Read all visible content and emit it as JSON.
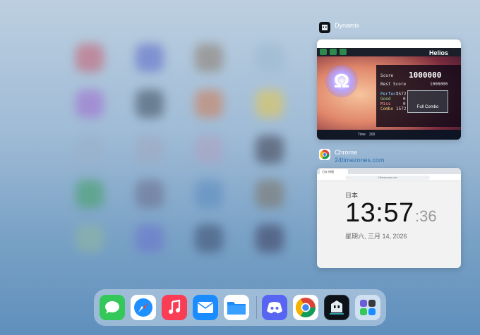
{
  "switcher": {
    "cards": [
      {
        "app_name": "Dynamix",
        "subtitle": "",
        "icon": "dynamix-icon",
        "game": {
          "song_title": "Helios",
          "score_label": "Score",
          "score_value": "1000000",
          "best_score_label": "Best Score",
          "best_score_value": "1000000",
          "perfect_label": "Perfect",
          "perfect_value": "1572",
          "good_label": "Good",
          "good_value": "0",
          "miss_label": "Miss",
          "miss_value": "0",
          "combo_label": "Combo",
          "combo_value": "1572",
          "result_badge": "Full Combo",
          "omega_glyph": "Ω",
          "time_label": "Time",
          "time_value": "200"
        }
      },
      {
        "app_name": "Chrome",
        "subtitle": "24timezones.com",
        "icon": "chrome-icon",
        "page": {
          "tab_label": "日本 時間",
          "url": "24timezones.com",
          "country": "日本",
          "time_hm": "13:57",
          "time_sec": ":36",
          "date": "星期六, 三月 14, 2026"
        }
      }
    ]
  },
  "dock": {
    "apps": [
      {
        "name": "messages-icon",
        "color": "#34c759"
      },
      {
        "name": "safari-icon",
        "color": "#1e90ff"
      },
      {
        "name": "music-icon",
        "color": "#fa3c55"
      },
      {
        "name": "mail-icon",
        "color": "#1a8cff"
      },
      {
        "name": "files-icon",
        "color": "#1d8cf8"
      },
      {
        "name": "discord-icon",
        "color": "#5865f2"
      },
      {
        "name": "chrome-icon",
        "color": "#ffffff"
      },
      {
        "name": "dynamix-icon",
        "color": "#0d1118"
      },
      {
        "name": "app-library-icon",
        "color": "#cfe0f0"
      }
    ]
  }
}
